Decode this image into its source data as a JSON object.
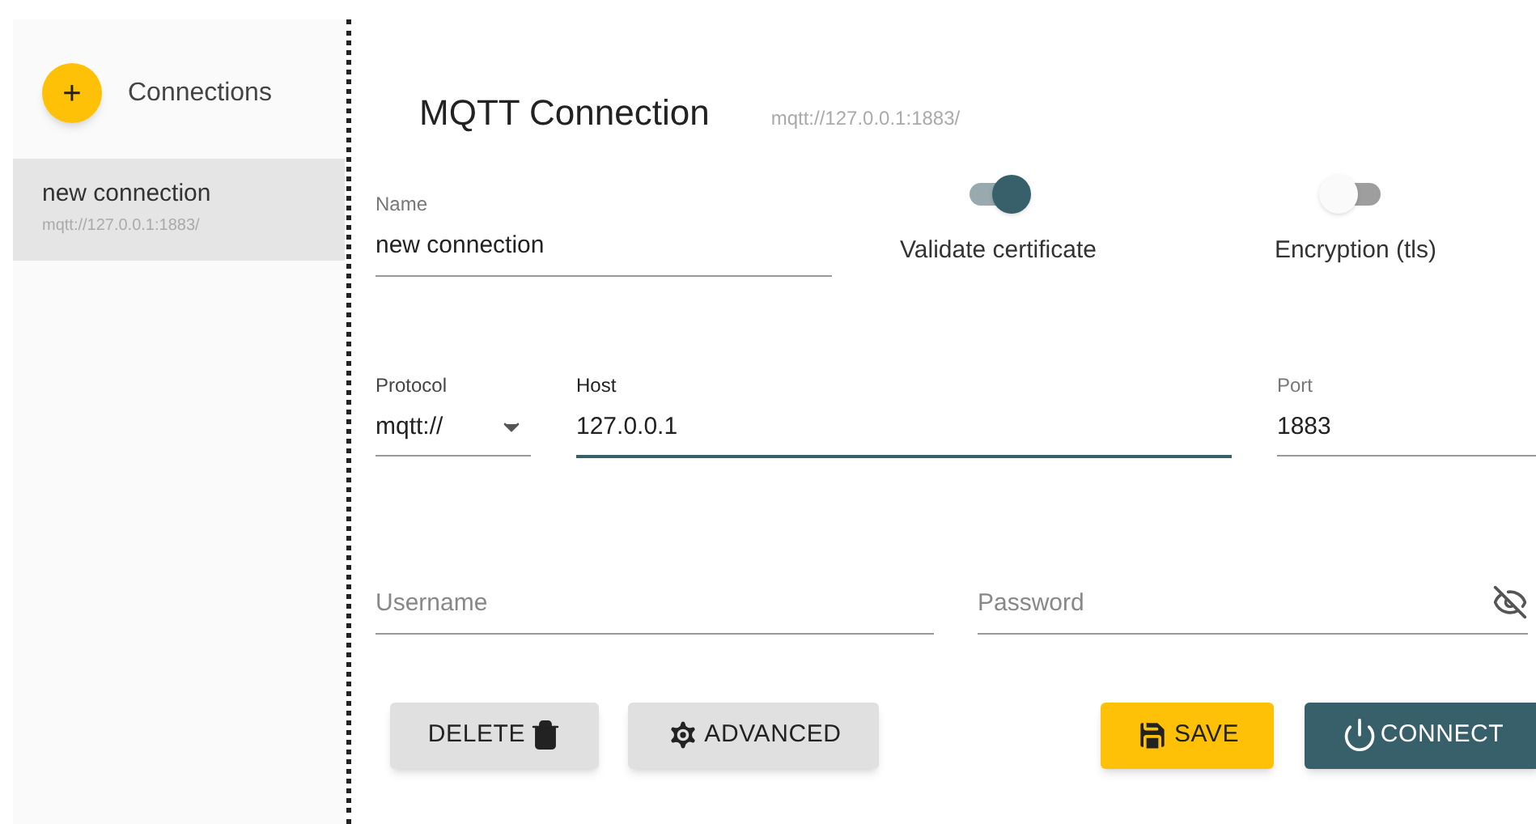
{
  "sidebar": {
    "title": "Connections",
    "add_button": "+",
    "items": [
      {
        "name": "new connection",
        "url": "mqtt://127.0.0.1:1883/",
        "selected": true
      }
    ]
  },
  "header": {
    "title": "MQTT Connection",
    "url": "mqtt://127.0.0.1:1883/"
  },
  "name_field": {
    "label": "Name",
    "value": "new connection"
  },
  "toggles": [
    {
      "label": "Validate certificate",
      "on": true
    },
    {
      "label": "Encryption (tls)",
      "on": false
    }
  ],
  "protocol_field": {
    "label": "Protocol",
    "value": "mqtt://"
  },
  "host_field": {
    "label": "Host",
    "value": "127.0.0.1",
    "focused": true
  },
  "port_field": {
    "label": "Port",
    "value": "1883"
  },
  "username_field": {
    "placeholder": "Username"
  },
  "password_field": {
    "placeholder": "Password"
  },
  "buttons": [
    {
      "label": "DELETE",
      "kind": "delete"
    },
    {
      "label": "ADVANCED",
      "kind": "advanced"
    },
    {
      "label": "SAVE",
      "kind": "save"
    },
    {
      "label": "CONNECT",
      "kind": "connect"
    }
  ]
}
